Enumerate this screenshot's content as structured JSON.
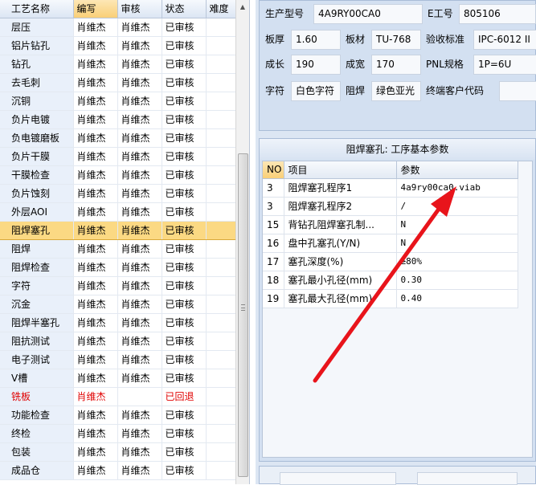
{
  "process_grid": {
    "headers": [
      "工艺名称",
      "编写",
      "审核",
      "状态",
      "难度"
    ],
    "rows": [
      {
        "name": "层压",
        "writer": "肖维杰",
        "reviewer": "肖维杰",
        "status": "已审核",
        "difficulty": ""
      },
      {
        "name": "铝片钻孔",
        "writer": "肖维杰",
        "reviewer": "肖维杰",
        "status": "已审核",
        "difficulty": ""
      },
      {
        "name": "钻孔",
        "writer": "肖维杰",
        "reviewer": "肖维杰",
        "status": "已审核",
        "difficulty": ""
      },
      {
        "name": "去毛刺",
        "writer": "肖维杰",
        "reviewer": "肖维杰",
        "status": "已审核",
        "difficulty": ""
      },
      {
        "name": "沉铜",
        "writer": "肖维杰",
        "reviewer": "肖维杰",
        "status": "已审核",
        "difficulty": ""
      },
      {
        "name": "负片电镀",
        "writer": "肖维杰",
        "reviewer": "肖维杰",
        "status": "已审核",
        "difficulty": ""
      },
      {
        "name": "负电镀磨板",
        "writer": "肖维杰",
        "reviewer": "肖维杰",
        "status": "已审核",
        "difficulty": ""
      },
      {
        "name": "负片干膜",
        "writer": "肖维杰",
        "reviewer": "肖维杰",
        "status": "已审核",
        "difficulty": ""
      },
      {
        "name": "干膜检查",
        "writer": "肖维杰",
        "reviewer": "肖维杰",
        "status": "已审核",
        "difficulty": ""
      },
      {
        "name": "负片蚀刻",
        "writer": "肖维杰",
        "reviewer": "肖维杰",
        "status": "已审核",
        "difficulty": ""
      },
      {
        "name": "外层AOI",
        "writer": "肖维杰",
        "reviewer": "肖维杰",
        "status": "已审核",
        "difficulty": ""
      },
      {
        "name": "阻焊塞孔",
        "writer": "肖维杰",
        "reviewer": "肖维杰",
        "status": "已审核",
        "difficulty": "",
        "selected": true
      },
      {
        "name": "阻焊",
        "writer": "肖维杰",
        "reviewer": "肖维杰",
        "status": "已审核",
        "difficulty": ""
      },
      {
        "name": "阻焊检查",
        "writer": "肖维杰",
        "reviewer": "肖维杰",
        "status": "已审核",
        "difficulty": ""
      },
      {
        "name": "字符",
        "writer": "肖维杰",
        "reviewer": "肖维杰",
        "status": "已审核",
        "difficulty": ""
      },
      {
        "name": "沉金",
        "writer": "肖维杰",
        "reviewer": "肖维杰",
        "status": "已审核",
        "difficulty": ""
      },
      {
        "name": "阻焊半塞孔",
        "writer": "肖维杰",
        "reviewer": "肖维杰",
        "status": "已审核",
        "difficulty": ""
      },
      {
        "name": "阻抗测试",
        "writer": "肖维杰",
        "reviewer": "肖维杰",
        "status": "已审核",
        "difficulty": ""
      },
      {
        "name": "电子测试",
        "writer": "肖维杰",
        "reviewer": "肖维杰",
        "status": "已审核",
        "difficulty": ""
      },
      {
        "name": "V槽",
        "writer": "肖维杰",
        "reviewer": "肖维杰",
        "status": "已审核",
        "difficulty": ""
      },
      {
        "name": "铣板",
        "writer": "肖维杰",
        "reviewer": "",
        "status": "已回退",
        "difficulty": "",
        "returned": true
      },
      {
        "name": "功能检查",
        "writer": "肖维杰",
        "reviewer": "肖维杰",
        "status": "已审核",
        "difficulty": ""
      },
      {
        "name": "终检",
        "writer": "肖维杰",
        "reviewer": "肖维杰",
        "status": "已审核",
        "difficulty": ""
      },
      {
        "name": "包装",
        "writer": "肖维杰",
        "reviewer": "肖维杰",
        "status": "已审核",
        "difficulty": ""
      },
      {
        "name": "成品仓",
        "writer": "肖维杰",
        "reviewer": "肖维杰",
        "status": "已审核",
        "difficulty": ""
      }
    ]
  },
  "product_info": {
    "model_label": "生产型号",
    "model": "4A9RY00CA0",
    "eng_label": "E工号",
    "eng": "805106",
    "thickness_label": "板厚",
    "thickness": "1.60",
    "material_label": "板材",
    "material": "TU-768",
    "standard_label": "验收标准",
    "standard": "IPC-6012 II",
    "length_label": "成长",
    "length": "190",
    "width_label": "成宽",
    "width": "170",
    "pnl_label": "PNL规格",
    "pnl": "1P=6U",
    "char_label": "字符",
    "char": "白色字符",
    "mask_label": "阻焊",
    "mask": "绿色亚光",
    "customer_label": "终端客户代码",
    "customer": ""
  },
  "param_panel": {
    "title": "阻焊塞孔: 工序基本参数",
    "headers": [
      "NO",
      "项目",
      "参数"
    ],
    "rows": [
      {
        "no": "3",
        "item": "阻焊塞孔程序1",
        "value": "4a9ry00ca0.viab"
      },
      {
        "no": "3",
        "item": "阻焊塞孔程序2",
        "value": "/"
      },
      {
        "no": "15",
        "item": "背钻孔阻焊塞孔制...",
        "value": "N"
      },
      {
        "no": "16",
        "item": "盘中孔塞孔(Y/N)",
        "value": "N"
      },
      {
        "no": "17",
        "item": "塞孔深度(%)",
        "value": "≥80%"
      },
      {
        "no": "18",
        "item": "塞孔最小孔径(mm)",
        "value": "0.30"
      },
      {
        "no": "19",
        "item": "塞孔最大孔径(mm)",
        "value": "0.40"
      }
    ]
  },
  "annotation": {
    "color": "#e8141b"
  }
}
